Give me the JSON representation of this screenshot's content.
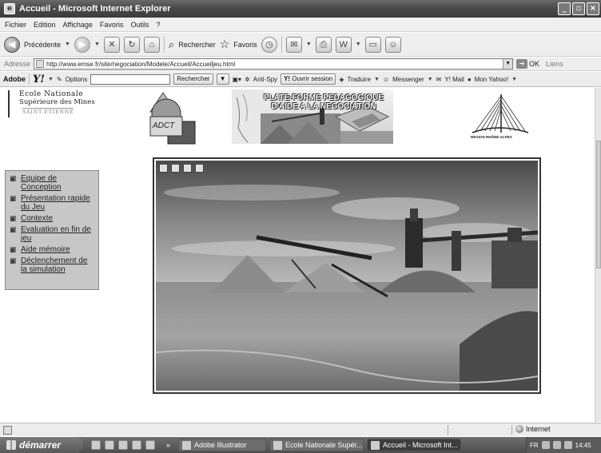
{
  "window": {
    "title": "Accueil - Microsoft Internet Explorer"
  },
  "menu": [
    "Fichier",
    "Edition",
    "Affichage",
    "Favoris",
    "Outils",
    "?"
  ],
  "toolbar": {
    "back_label": "Précédente",
    "search_label": "Rechercher",
    "favorites_label": "Favoris"
  },
  "address": {
    "label": "Adresse",
    "url": "http://www.emse.fr/site/negociation/Modele/Accueil/Accueiljeu.html",
    "go_label": "OK",
    "links_label": "Liens"
  },
  "yahoo_toolbar": {
    "adobe_label": "Adobe",
    "yahoo_label": "Y!",
    "options_label": "Options",
    "search_button": "Rechercher",
    "antispy_label": "Anti-Spy",
    "session_label": "Ouvrir session",
    "translate_label": "Traduire",
    "messenger_label": "Messenger",
    "mail_label": "Y! Mail",
    "myyahoo_label": "Mon Yahoo!"
  },
  "header": {
    "school_line1": "Ecole Nationale",
    "school_line2": "Supérieure des Mines",
    "school_line3": "SAINT-ETIENNE",
    "adct_label": "ADCT",
    "banner_line1": "PLATE-FORME PEDAGOGIQUE",
    "banner_line2": "D'AIDE A LA NEGOCIATION",
    "region_label": "REGION RHÔNE-ALPES"
  },
  "nav": [
    {
      "label": "Equipe de Conception"
    },
    {
      "label": "Présentation rapide du Jeu"
    },
    {
      "label": "Contexte"
    },
    {
      "label": "Evaluation en fin de jeu"
    },
    {
      "label": "Aide mémoire"
    },
    {
      "label": "Déclenchement de la simulation"
    }
  ],
  "status": {
    "zone_label": "Internet"
  },
  "taskbar": {
    "start_label": "démarrer",
    "tasks": [
      {
        "label": "Adobe Illustrator"
      },
      {
        "label": "Ecole Nationale Supér..."
      },
      {
        "label": "Accueil - Microsoft Int..."
      }
    ],
    "lang": "FR",
    "clock": "14:45"
  }
}
